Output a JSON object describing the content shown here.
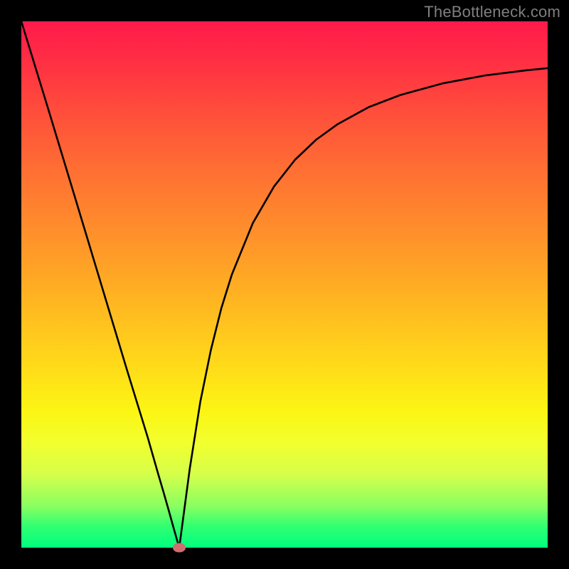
{
  "watermark": "TheBottleneck.com",
  "chart_data": {
    "type": "line",
    "title": "",
    "xlabel": "",
    "ylabel": "",
    "xlim": [
      0,
      100
    ],
    "ylim": [
      0,
      100
    ],
    "grid": false,
    "series": [
      {
        "name": "curve",
        "x": [
          0,
          5,
          10,
          15,
          20,
          22,
          24,
          26,
          27,
          28,
          29,
          30,
          31,
          32,
          34,
          36,
          38,
          40,
          44,
          48,
          52,
          56,
          60,
          66,
          72,
          80,
          88,
          96,
          100
        ],
        "values": [
          100,
          83.7,
          67.2,
          50.6,
          34.0,
          27.5,
          21.0,
          14.0,
          10.6,
          7.1,
          3.5,
          0.0,
          7.5,
          15.0,
          27.7,
          37.5,
          45.5,
          51.9,
          61.7,
          68.6,
          73.7,
          77.5,
          80.4,
          83.7,
          86.0,
          88.2,
          89.7,
          90.7,
          91.1
        ]
      }
    ],
    "marker": {
      "x": 30,
      "y": 0
    },
    "gradient_colors_top_to_bottom": [
      "#ff1a4b",
      "#00ff7e"
    ]
  }
}
